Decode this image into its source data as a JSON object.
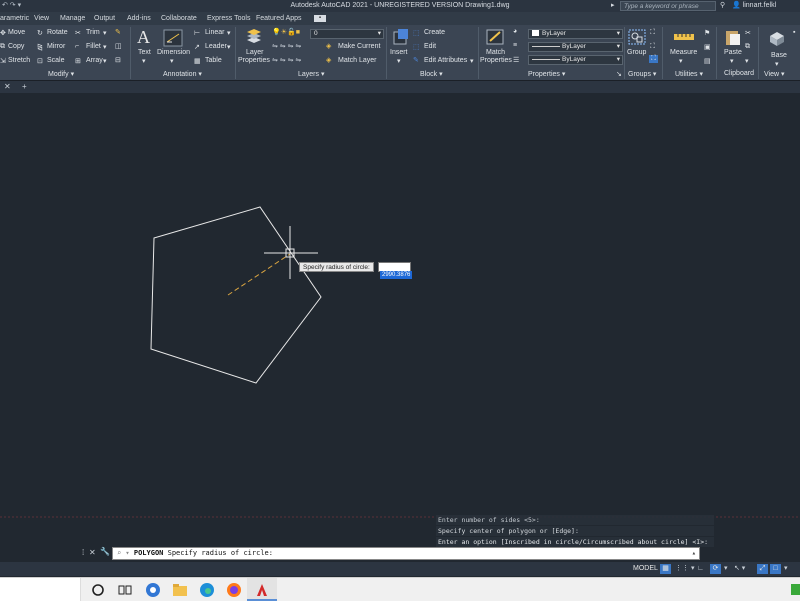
{
  "titlebar": {
    "title": "Autodesk AutoCAD 2021 - UNREGISTERED VERSION   Drawing1.dwg",
    "search_placeholder": "Type a keyword or phrase",
    "username": "linnart.felkl"
  },
  "ribbon_tabs": [
    "arametric",
    "View",
    "Manage",
    "Output",
    "Add-ins",
    "Collaborate",
    "Express Tools",
    "Featured Apps"
  ],
  "modify": {
    "move": "Move",
    "rotate": "Rotate",
    "trim": "Trim",
    "copy": "Copy",
    "mirror": "Mirror",
    "fillet": "Fillet",
    "stretch": "Stretch",
    "scale": "Scale",
    "array": "Array",
    "title": "Modify"
  },
  "annotation": {
    "text": "Text",
    "dimension": "Dimension",
    "linear": "Linear",
    "leader": "Leader",
    "table": "Table",
    "title": "Annotation"
  },
  "layers": {
    "layer_properties_1": "Layer",
    "layer_properties_2": "Properties",
    "current_layer": "0",
    "make_current": "Make Current",
    "match_layer": "Match Layer",
    "title": "Layers"
  },
  "block": {
    "insert": "Insert",
    "create": "Create",
    "edit": "Edit",
    "edit_attributes": "Edit Attributes",
    "title": "Block"
  },
  "properties": {
    "match_1": "Match",
    "match_2": "Properties",
    "color": "ByLayer",
    "lineweight": "ByLayer",
    "linetype": "ByLayer",
    "title": "Properties"
  },
  "groups": {
    "group": "Group",
    "title": "Groups"
  },
  "utilities": {
    "measure": "Measure",
    "title": "Utilities"
  },
  "clipboard": {
    "paste": "Paste",
    "title": "Clipboard"
  },
  "view": {
    "base": "Base",
    "title": "View"
  },
  "canvas": {
    "tooltip_label": "Specify radius of circle:",
    "tooltip_value": "2990.3876"
  },
  "command_history": [
    "Enter number of sides <5>:",
    "Specify center of polygon or [Edge]:",
    "Enter an option [Inscribed in circle/Circumscribed about circle] <I>: C"
  ],
  "command_line": {
    "command": "POLYGON",
    "prompt": "Specify radius of circle:"
  },
  "statusbar": {
    "model": "MODEL"
  },
  "colors": {
    "canvas": "#212830",
    "ribbon": "#3b4553",
    "accent": "#1e68d6",
    "tracking": "#d9a441"
  }
}
